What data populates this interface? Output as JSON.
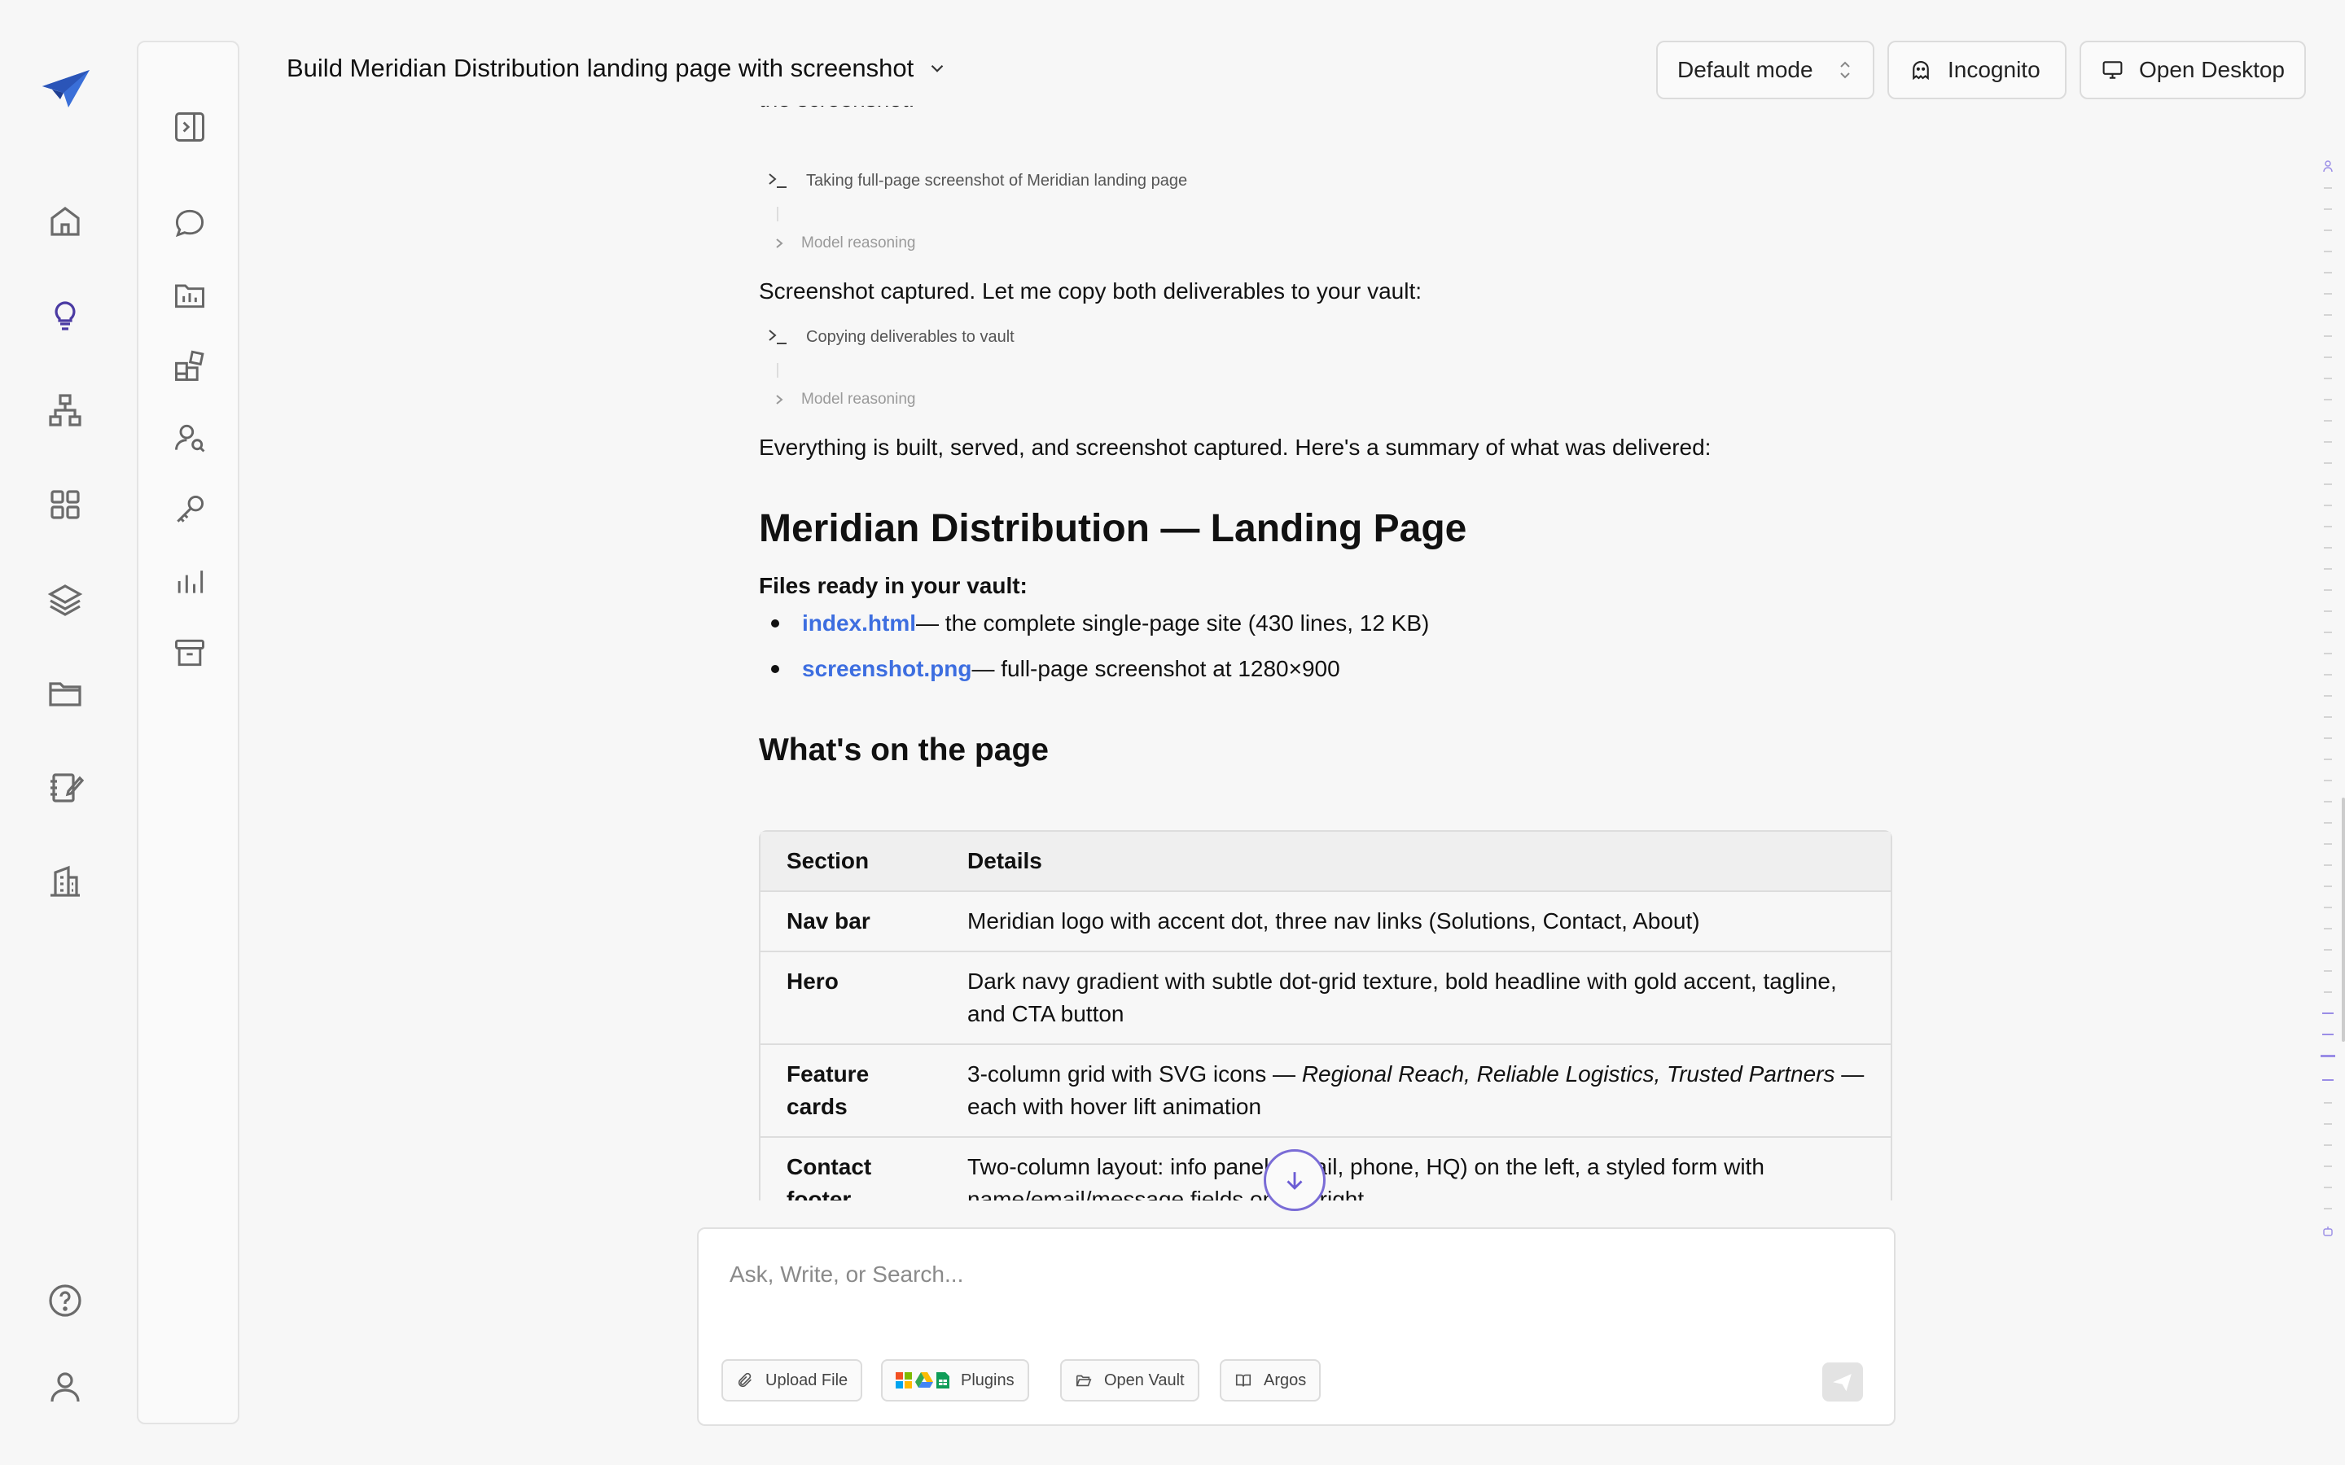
{
  "header": {
    "title": "Build Meridian Distribution landing page with screenshot",
    "mode_label": "Default mode",
    "incognito_label": "Incognito",
    "open_desktop_label": "Open Desktop"
  },
  "rail": {
    "icons": [
      "logo-icon",
      "home-icon",
      "lightbulb-icon",
      "org-chart-icon",
      "apps-grid-icon",
      "layers-icon",
      "folder-icon",
      "notes-edit-icon",
      "building-icon",
      "help-icon",
      "user-icon"
    ]
  },
  "panel": {
    "icons": [
      "collapse-panel-icon",
      "chat-bubble-icon",
      "folder-chart-icon",
      "widgets-icon",
      "user-search-icon",
      "key-icon",
      "bar-chart-icon",
      "archive-icon"
    ]
  },
  "chat": {
    "partial_text": "the screenshot:",
    "step1_label": "Taking full-page screenshot of Meridian landing page",
    "reasoning_label": "Model reasoning",
    "para1": "Screenshot captured. Let me copy both deliverables to your vault:",
    "step2_label": "Copying deliverables to vault",
    "para2": "Everything is built, served, and screenshot captured. Here's a summary of what was delivered:",
    "heading": "Meridian Distribution — Landing Page",
    "files_label": "Files ready in your vault:",
    "files": [
      {
        "name": "index.html",
        "desc": " — the complete single-page site (430 lines, 12 KB)"
      },
      {
        "name": "screenshot.png",
        "desc": " — full-page screenshot at 1280×900"
      }
    ],
    "subheading": "What's on the page",
    "table": {
      "headers": [
        "Section",
        "Details"
      ],
      "rows": [
        {
          "section": "Nav bar",
          "details": "Meridian logo with accent dot, three nav links (Solutions, Contact, About)"
        },
        {
          "section": "Hero",
          "details": "Dark navy gradient with subtle dot-grid texture, bold headline with gold accent, tagline, and CTA button"
        },
        {
          "section": "Feature cards",
          "details_pre": "3-column grid with SVG icons — ",
          "details_em": "Regional Reach, Reliable Logistics, Trusted Partners",
          "details_post": " — each with hover lift animation"
        },
        {
          "section": "Contact footer",
          "details": "Two-column layout: info panel (email, phone, HQ) on the left, a styled form with name/email/message fields on the right"
        }
      ]
    }
  },
  "composer": {
    "placeholder": "Ask, Write, or Search...",
    "upload_label": "Upload File",
    "plugins_label": "Plugins",
    "vault_label": "Open Vault",
    "argos_label": "Argos"
  },
  "colors": {
    "accent": "#4b3ba3",
    "link": "#3d6ee0",
    "scroll_accent": "#7a6cd6"
  }
}
